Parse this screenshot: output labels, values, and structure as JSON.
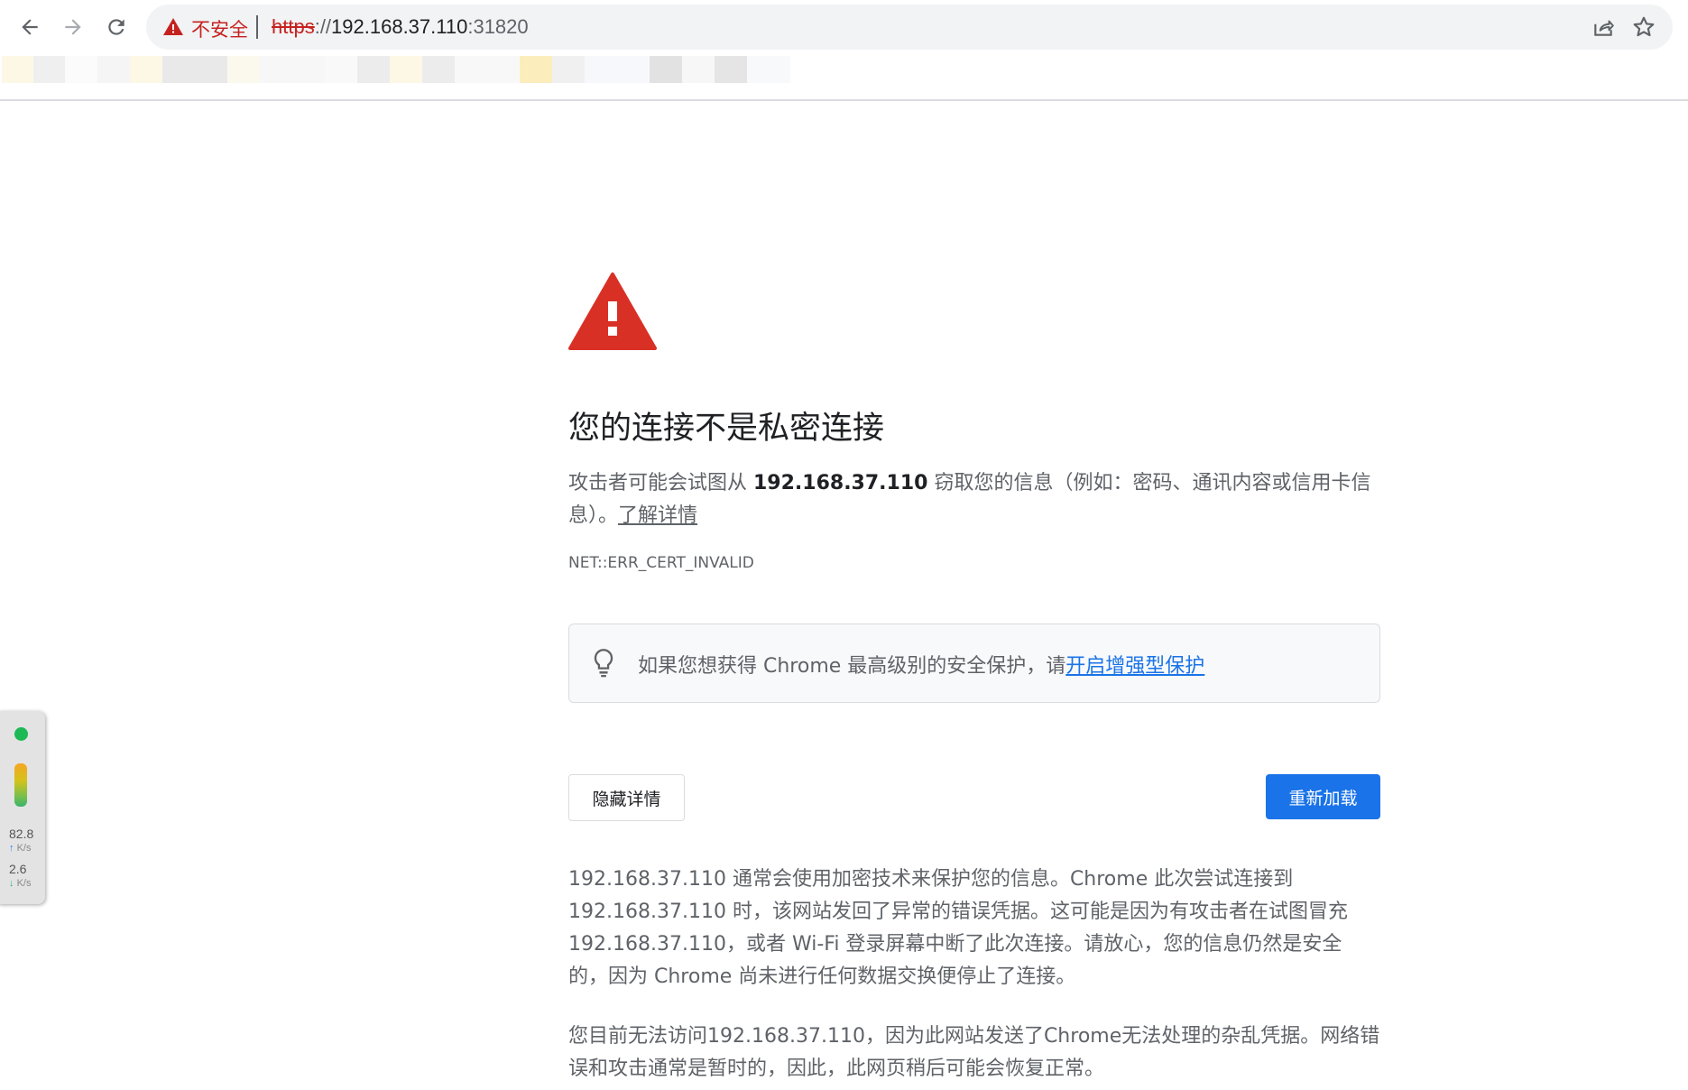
{
  "browser": {
    "insecure_label": "不安全",
    "url_scheme": "https",
    "url_separator": "://",
    "url_host": "192.168.37.110",
    "url_port": ":31820",
    "icons": [
      "back-arrow-icon",
      "forward-arrow-icon",
      "reload-icon",
      "warning-icon",
      "share-icon",
      "star-icon"
    ]
  },
  "page": {
    "title": "您的连接不是私密连接",
    "intro_before": "攻击者可能会试图从 ",
    "intro_host": "192.168.37.110",
    "intro_after": " 窃取您的信息（例如：密码、通讯内容或信用卡信息）。",
    "learn_more": "了解详情",
    "error_code": "NET::ERR_CERT_INVALID",
    "enhanced_text": "如果您想获得 Chrome 最高级别的安全保护，请",
    "enhanced_link": "开启增强型保护",
    "hide_details_button": "隐藏详情",
    "reload_button": "重新加载",
    "details_paragraph_1": "192.168.37.110 通常会使用加密技术来保护您的信息。Chrome 此次尝试连接到 192.168.37.110 时，该网站发回了异常的错误凭据。这可能是因为有攻击者在试图冒充 192.168.37.110，或者 Wi-Fi 登录屏幕中断了此次连接。请放心，您的信息仍然是安全的，因为 Chrome 尚未进行任何数据交换便停止了连接。",
    "details_paragraph_2": "您目前无法访问192.168.37.110，因为此网站发送了Chrome无法处理的杂乱凭据。网络错误和攻击通常是暂时的，因此，此网页稍后可能会恢复正常。"
  },
  "speed_widget": {
    "upload_value": "82.8",
    "upload_unit": "K/s",
    "download_value": "2.6",
    "download_unit": "K/s",
    "status_color": "#1db954"
  },
  "colors": {
    "warning_red": "#d93025",
    "link_blue": "#1a73e8",
    "primary_button": "#1a73e8"
  }
}
